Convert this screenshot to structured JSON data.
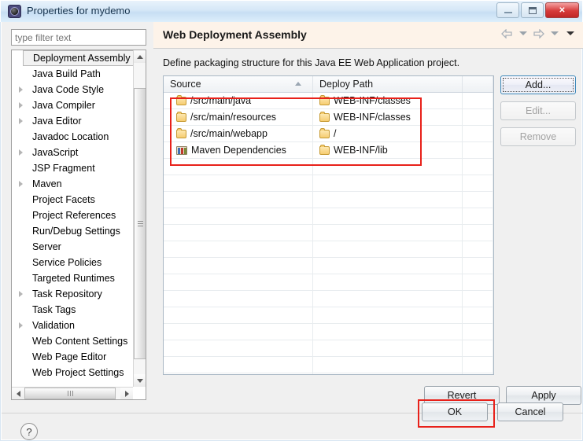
{
  "window": {
    "title": "Properties for mydemo",
    "icon": "properties-gear-icon",
    "minimize_label": "Minimize",
    "maximize_label": "Maximize",
    "close_label": "Close"
  },
  "filter": {
    "placeholder": "type filter text",
    "value": ""
  },
  "tree": {
    "items": [
      {
        "label": "Deployment Assembly",
        "expandable": false,
        "selected": true
      },
      {
        "label": "Java Build Path",
        "expandable": false,
        "selected": false
      },
      {
        "label": "Java Code Style",
        "expandable": true,
        "selected": false
      },
      {
        "label": "Java Compiler",
        "expandable": true,
        "selected": false
      },
      {
        "label": "Java Editor",
        "expandable": true,
        "selected": false
      },
      {
        "label": "Javadoc Location",
        "expandable": false,
        "selected": false
      },
      {
        "label": "JavaScript",
        "expandable": true,
        "selected": false
      },
      {
        "label": "JSP Fragment",
        "expandable": false,
        "selected": false
      },
      {
        "label": "Maven",
        "expandable": true,
        "selected": false
      },
      {
        "label": "Project Facets",
        "expandable": false,
        "selected": false
      },
      {
        "label": "Project References",
        "expandable": false,
        "selected": false
      },
      {
        "label": "Run/Debug Settings",
        "expandable": false,
        "selected": false
      },
      {
        "label": "Server",
        "expandable": false,
        "selected": false
      },
      {
        "label": "Service Policies",
        "expandable": false,
        "selected": false
      },
      {
        "label": "Targeted Runtimes",
        "expandable": false,
        "selected": false
      },
      {
        "label": "Task Repository",
        "expandable": true,
        "selected": false
      },
      {
        "label": "Task Tags",
        "expandable": false,
        "selected": false
      },
      {
        "label": "Validation",
        "expandable": true,
        "selected": false
      },
      {
        "label": "Web Content Settings",
        "expandable": false,
        "selected": false
      },
      {
        "label": "Web Page Editor",
        "expandable": false,
        "selected": false
      },
      {
        "label": "Web Project Settings",
        "expandable": false,
        "selected": false
      }
    ]
  },
  "panel": {
    "title": "Web Deployment Assembly",
    "description": "Define packaging structure for this Java EE Web Application project.",
    "nav": {
      "back_icon": "arrow-back-icon",
      "back_menu_icon": "chevron-down-icon",
      "forward_icon": "arrow-forward-icon",
      "forward_menu_icon": "chevron-down-icon",
      "view_menu_icon": "chevron-down-icon"
    }
  },
  "table": {
    "columns": [
      "Source",
      "Deploy Path",
      ""
    ],
    "sort_column": "Source",
    "sort_indicator": "sort-ascending-icon",
    "rows": [
      {
        "icon": "folder-icon",
        "source": "/src/main/java",
        "deploy_icon": "folder-icon",
        "deploy": "WEB-INF/classes"
      },
      {
        "icon": "folder-icon",
        "source": "/src/main/resources",
        "deploy_icon": "folder-icon",
        "deploy": "WEB-INF/classes"
      },
      {
        "icon": "folder-icon",
        "source": "/src/main/webapp",
        "deploy_icon": "folder-icon",
        "deploy": "/"
      },
      {
        "icon": "library-icon",
        "source": "Maven Dependencies",
        "deploy_icon": "folder-icon",
        "deploy": "WEB-INF/lib"
      }
    ],
    "empty_row_count": 14
  },
  "side_buttons": [
    {
      "label": "Add...",
      "mnemonic": "A",
      "state": "focused"
    },
    {
      "label": "Edit...",
      "mnemonic": "E",
      "state": "disabled"
    },
    {
      "label": "Remove",
      "mnemonic": "R",
      "state": "disabled"
    }
  ],
  "apply_buttons": {
    "revert": "Revert",
    "revert_mnemonic": "v",
    "apply": "Apply",
    "apply_mnemonic": "A"
  },
  "footer": {
    "help_icon": "help-question-icon",
    "ok": "OK",
    "cancel": "Cancel"
  },
  "annotations": {
    "highlight_color": "#e8211a",
    "boxes": [
      "table-rows-highlight",
      "ok-button-highlight"
    ]
  },
  "scrollbars": {
    "tree_vertical": "tree-vertical-scrollbar",
    "tree_horizontal": "tree-horizontal-scrollbar"
  }
}
